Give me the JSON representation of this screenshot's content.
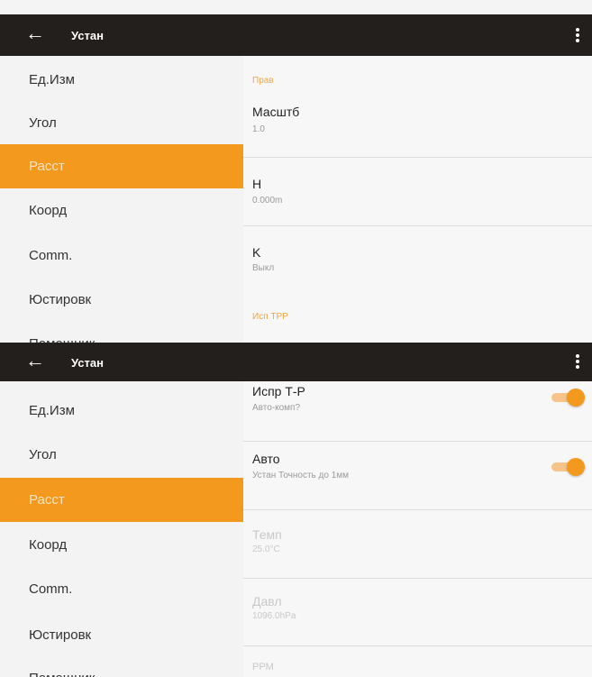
{
  "screens": [
    {
      "title": "Устан",
      "sidebar": {
        "items": [
          {
            "label": "Ед.Изм",
            "active": false
          },
          {
            "label": "Угол",
            "active": false
          },
          {
            "label": "Расст",
            "active": true
          },
          {
            "label": "Коорд",
            "active": false
          },
          {
            "label": "Comm.",
            "active": false
          },
          {
            "label": "Юстировк",
            "active": false
          },
          {
            "label": "Помощник",
            "active": false
          }
        ]
      },
      "content": {
        "section1": "Прав",
        "rows": [
          {
            "title": "Масштб",
            "value": "1.0"
          },
          {
            "title": "H",
            "value": "0.000m"
          },
          {
            "title": "K",
            "value": "Выкл"
          }
        ],
        "section2": "Исп ТРР"
      }
    },
    {
      "title": "Устан",
      "sidebar": {
        "items": [
          {
            "label": "Ед.Изм",
            "active": false
          },
          {
            "label": "Угол",
            "active": false
          },
          {
            "label": "Расст",
            "active": true
          },
          {
            "label": "Коорд",
            "active": false
          },
          {
            "label": "Comm.",
            "active": false
          },
          {
            "label": "Юстировк",
            "active": false
          },
          {
            "label": "Помощник",
            "active": false
          }
        ]
      },
      "content": {
        "rows": [
          {
            "title": "Испр Т-Р",
            "value": "Авто-комп?",
            "toggle": true,
            "enabled": true
          },
          {
            "title": "Авто",
            "value": "Устан Точность до 1мм",
            "toggle": true,
            "enabled": true
          },
          {
            "title": "Темп",
            "value": "25.0°C",
            "enabled": false
          },
          {
            "title": "Давл",
            "value": "1096.0hPa",
            "enabled": false
          },
          {
            "title": "PPM",
            "value": "",
            "enabled": false
          }
        ]
      }
    }
  ],
  "colors": {
    "accent": "#f39a1e",
    "topbar": "#231f1c"
  }
}
